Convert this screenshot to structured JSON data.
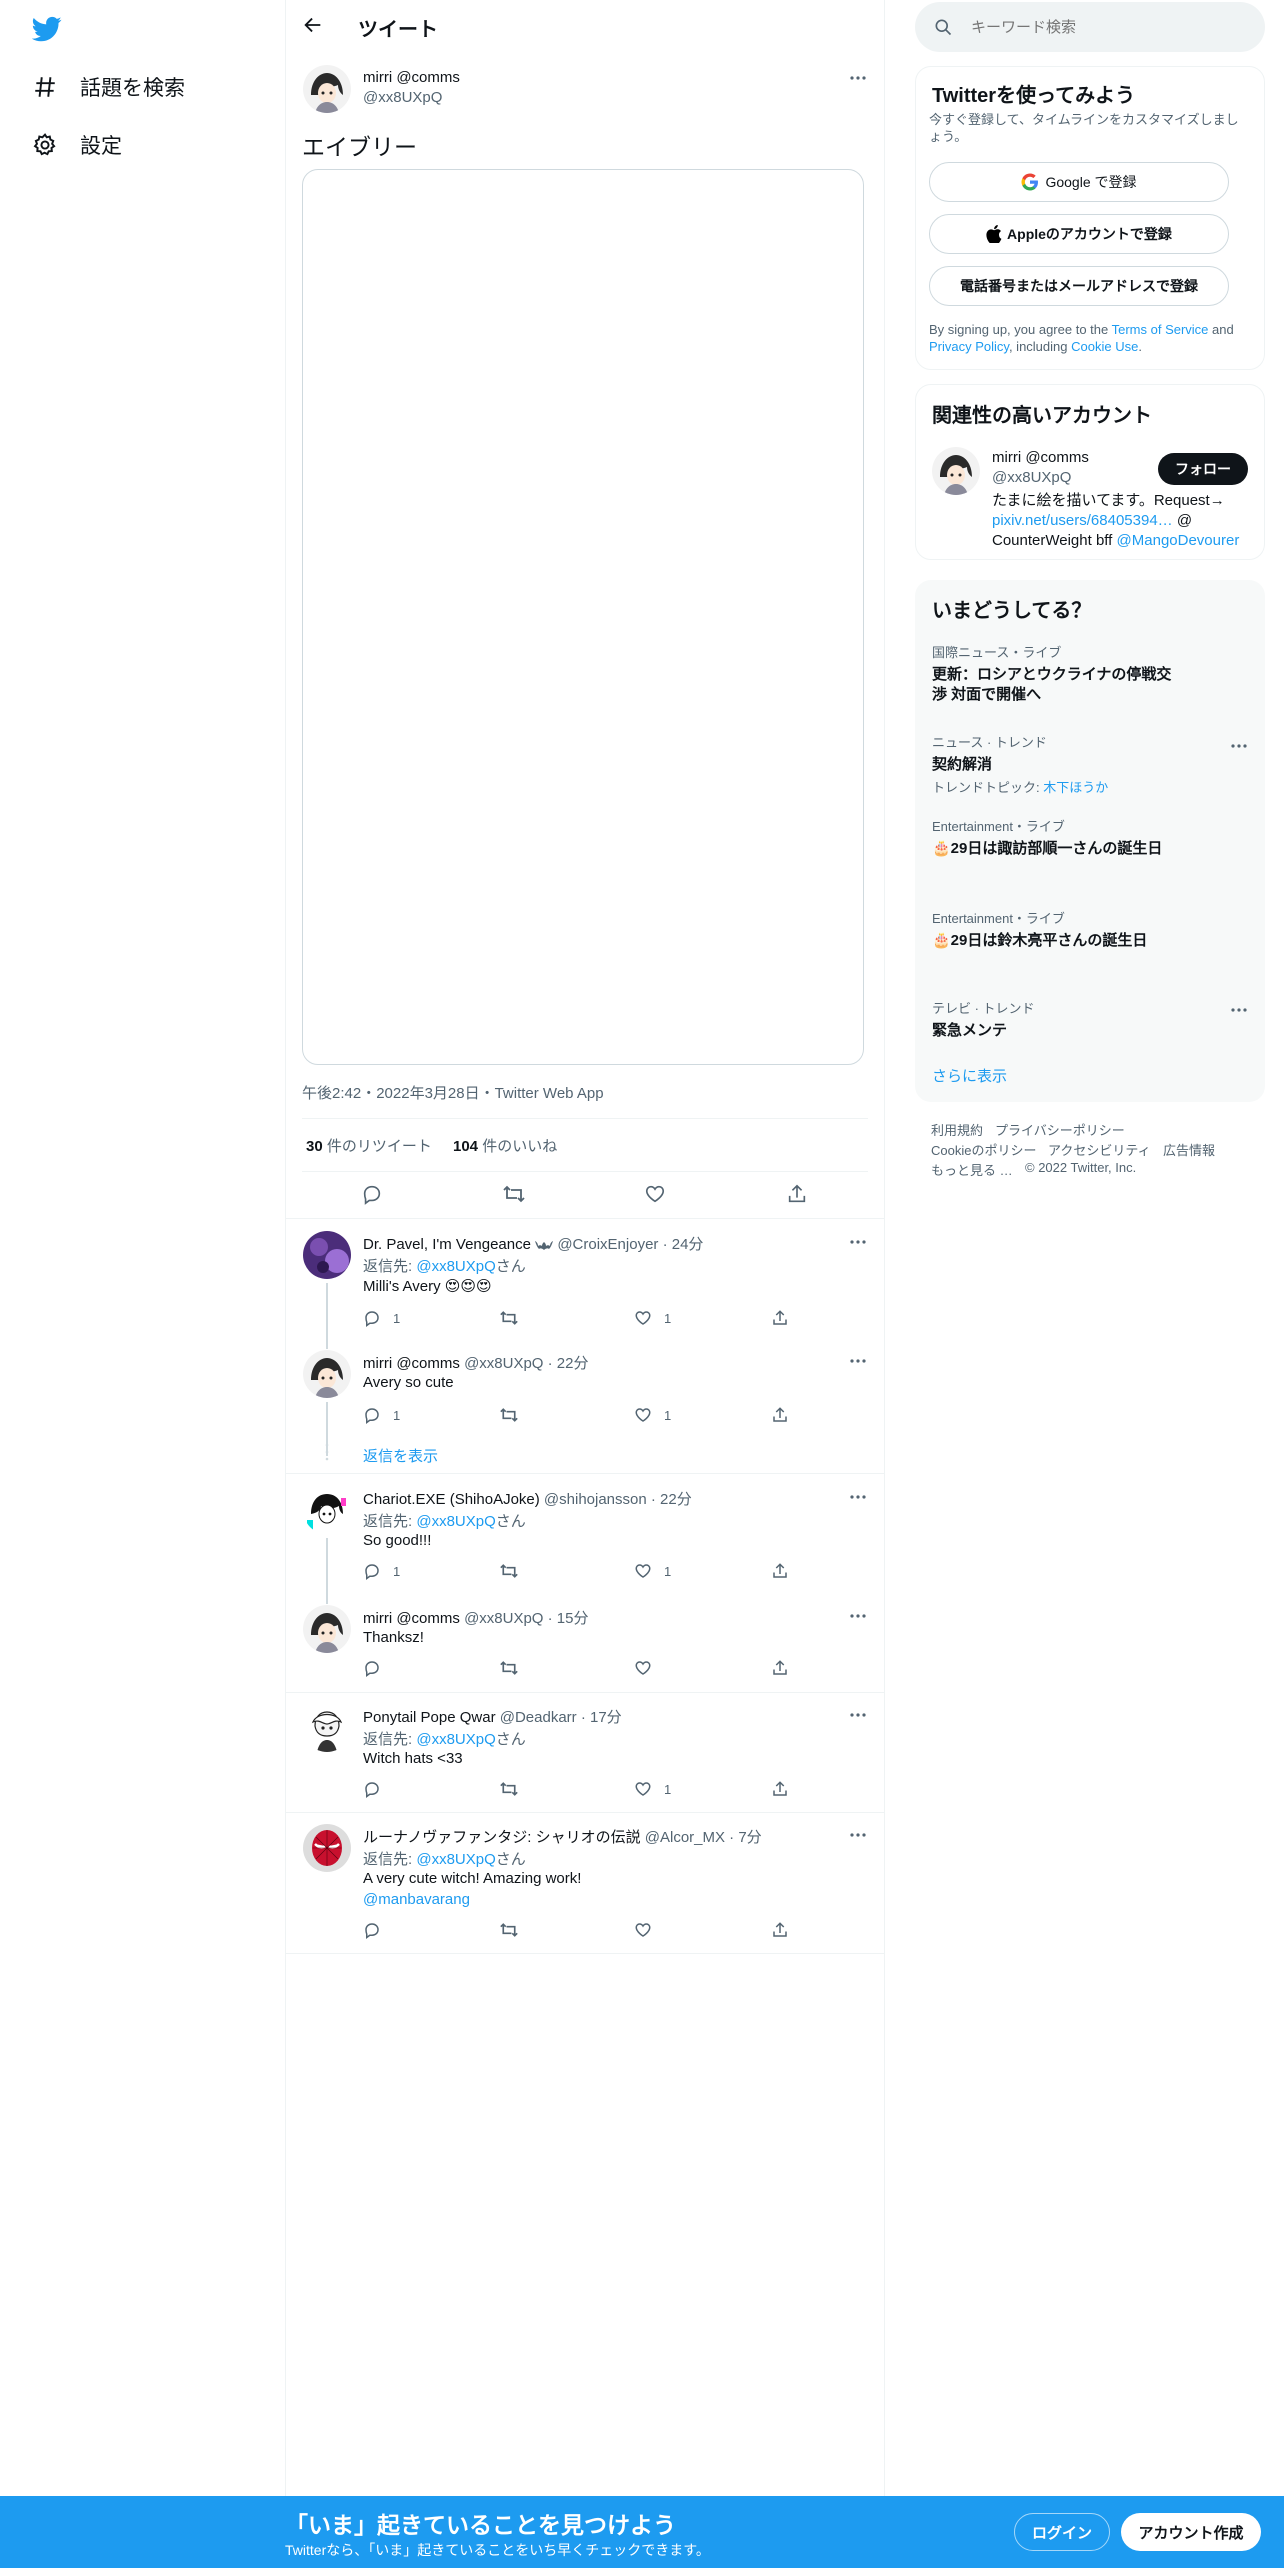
{
  "nav": {
    "explore_label": "話題を検索",
    "settings_label": "設定"
  },
  "header": {
    "title": "ツイート"
  },
  "tweet": {
    "author_name": "mirri @comms",
    "author_handle": "@xx8UXpQ",
    "text": "エイブリー",
    "timestamp": "午後2:42・2022年3月28日・Twitter Web App",
    "retweet_count": "30",
    "retweet_label": "件のリツイート",
    "like_count": "104",
    "like_label": "件のいいね"
  },
  "replies": [
    {
      "name": "Dr. Pavel, I'm Vengeance",
      "handle_time": "@CroixEnjoyer · 24分",
      "reply_prefix": "返信先:",
      "reply_to": "@xx8UXpQ",
      "reply_suffix": "さん",
      "text": "Milli's Avery 😍😍😍",
      "reply_count": "1",
      "like_count": "1"
    },
    {
      "name": "mirri @comms",
      "handle_time": "@xx8UXpQ · 22分",
      "text": "Avery so cute",
      "reply_count": "1",
      "like_count": "1",
      "show_replies": "返信を表示"
    },
    {
      "name": "Chariot.EXE (ShihoAJoke)",
      "handle_time": "@shihojansson · 22分",
      "reply_prefix": "返信先:",
      "reply_to": "@xx8UXpQ",
      "reply_suffix": "さん",
      "text": "So good!!!",
      "reply_count": "1",
      "like_count": "1"
    },
    {
      "name": "mirri @comms",
      "handle_time": "@xx8UXpQ · 15分",
      "text": "Thanksz!"
    },
    {
      "name": "Ponytail Pope Qwar",
      "handle_time": "@Deadkarr · 17分",
      "reply_prefix": "返信先:",
      "reply_to": "@xx8UXpQ",
      "reply_suffix": "さん",
      "text": "Witch hats <33",
      "like_count": "1"
    },
    {
      "name": "ルーナノヴァファンタジ: シャリオの伝説",
      "handle_time": "@Alcor_MX · 7分",
      "reply_prefix": "返信先:",
      "reply_to": "@xx8UXpQ",
      "reply_suffix": "さん",
      "text": "A very cute witch! Amazing work!",
      "mention": "@manbavarang"
    }
  ],
  "search": {
    "placeholder": "キーワード検索"
  },
  "signup": {
    "title": "Twitterを使ってみよう",
    "subtitle": "今すぐ登録して、タイムラインをカスタマイズしましょう。",
    "google_label": "Google で登録",
    "apple_label": "Appleのアカウントで登録",
    "phone_label": "電話番号またはメールアドレスで登録",
    "legal_1": "By signing up, you agree to the ",
    "tos_link": "Terms of Service",
    "legal_2": " and ",
    "privacy_link": "Privacy Policy",
    "legal_3": ", including ",
    "cookie_link": "Cookie Use",
    "legal_4": "."
  },
  "related": {
    "title": "関連性の高いアカウント",
    "name": "mirri @comms",
    "handle": "@xx8UXpQ",
    "follow_label": "フォロー",
    "bio_1": "たまに絵を描いてます。Request→",
    "bio_link": "pixiv.net/users/68405394…",
    "bio_2": " @",
    "bio_3": "CounterWeight bff ",
    "bio_mention": "@MangoDevourer"
  },
  "trends": {
    "title": "いまどうしてる？",
    "items": [
      {
        "meta": "国際ニュース・ライブ",
        "title": "更新：ロシアとウクライナの停戦交渉 対面で開催へ"
      },
      {
        "meta": "ニュース · トレンド",
        "title": "契約解消",
        "sub_prefix": "トレンドトピック: ",
        "sub_link": "木下ほうか"
      },
      {
        "meta": "Entertainment・ライブ",
        "title": "🎂29日は諏訪部順一さんの誕生日"
      },
      {
        "meta": "Entertainment・ライブ",
        "title": "🎂29日は鈴木亮平さんの誕生日"
      },
      {
        "meta": "テレビ · トレンド",
        "title": "緊急メンテ"
      }
    ],
    "show_more": "さらに表示"
  },
  "footer": {
    "terms": "利用規約",
    "privacy": "プライバシーポリシー",
    "cookie": "Cookieのポリシー",
    "accessibility": "アクセシビリティ",
    "ads": "広告情報",
    "more": "もっと見る …",
    "copyright": "© 2022 Twitter, Inc."
  },
  "bottom_bar": {
    "title": "「いま」起きていることを見つけよう",
    "subtitle": "Twitterなら、「いま」起きていることをいち早くチェックできます。",
    "login_label": "ログイン",
    "signup_label": "アカウント作成"
  },
  "colors": {
    "brand": "#1d9bf0",
    "text": "#0f1419",
    "muted": "#536471"
  }
}
